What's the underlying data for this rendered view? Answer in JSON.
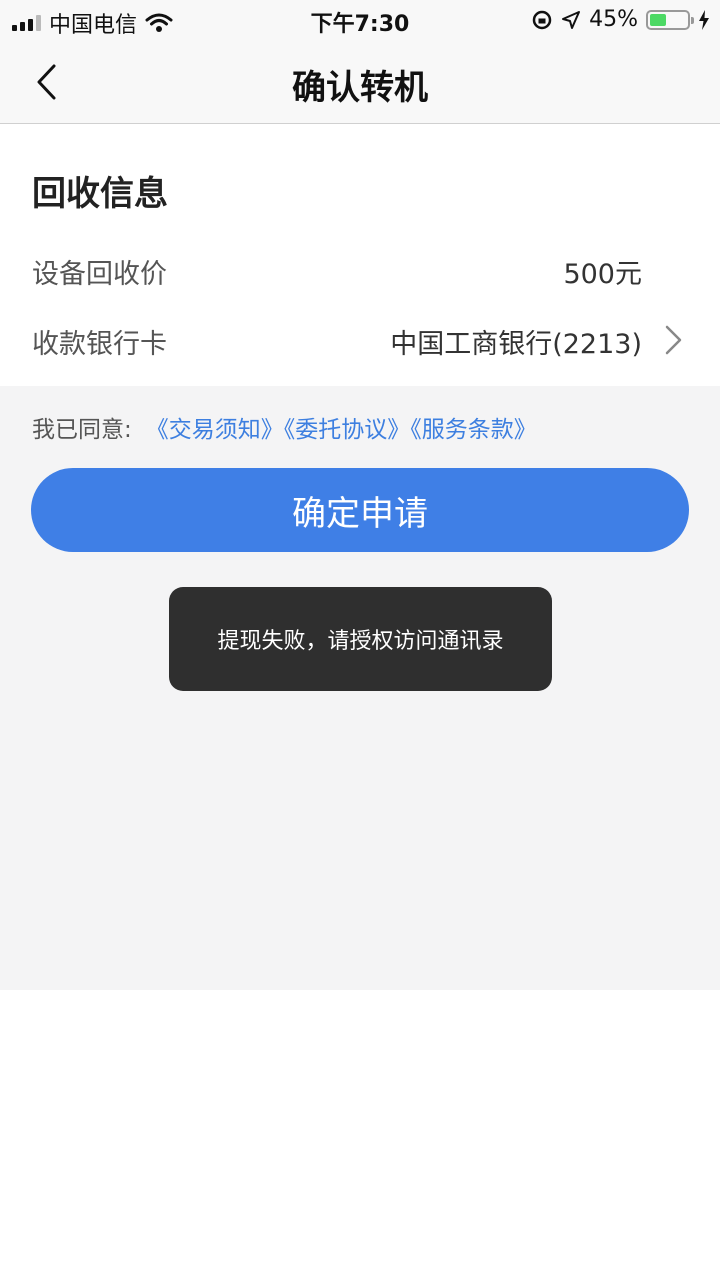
{
  "status_bar": {
    "carrier": "中国电信",
    "time": "下午7:30",
    "battery": "45%",
    "battery_level": 0.45
  },
  "nav": {
    "title": "确认转机"
  },
  "recycle_info": {
    "section_title": "回收信息",
    "price_label": "设备回收价",
    "price_value": "500元",
    "bank_label": "收款银行卡",
    "bank_value": "中国工商银行(2213)"
  },
  "agreement": {
    "label": "我已同意:",
    "links": [
      "《交易须知》",
      "《委托协议》",
      "《服务条款》"
    ]
  },
  "confirm_button": {
    "label": "确定申请"
  },
  "toast": {
    "message": "提现失败，请授权访问通讯录"
  },
  "colors": {
    "accent": "#3f7fe6",
    "link": "#3d7fe0",
    "toast_bg": "#2f2f2f",
    "battery_fill": "#4cd964"
  }
}
